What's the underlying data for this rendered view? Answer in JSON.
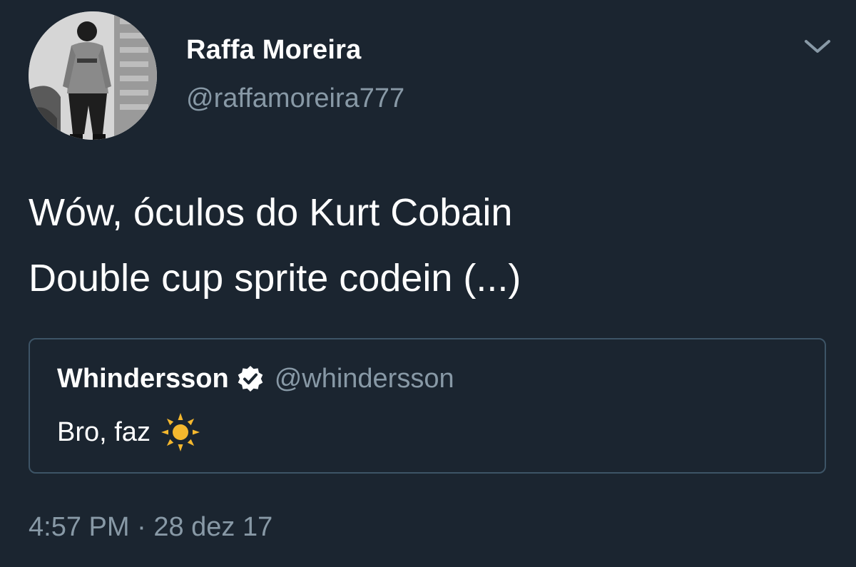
{
  "tweet": {
    "author": {
      "display_name": "Raffa Moreira",
      "handle": "@raffamoreira777",
      "avatar": "profile-photo"
    },
    "menu_icon": "chevron-down-icon",
    "text_lines": [
      "Wów, óculos do Kurt Cobain",
      "Double cup sprite codein (...)"
    ],
    "quoted_tweet": {
      "display_name": "Whindersson",
      "verified_icon": "verified-badge-icon",
      "handle": "@whindersson",
      "text": "Bro, faz",
      "emoji_icon": "sun-icon"
    },
    "time": "4:57 PM",
    "separator": "·",
    "date": "28 dez 17"
  },
  "colors": {
    "background": "#1b2530",
    "primary_text": "#ffffff",
    "secondary_text": "#8899a6",
    "card_border": "#3d5466",
    "sun": "#f5b82e"
  }
}
